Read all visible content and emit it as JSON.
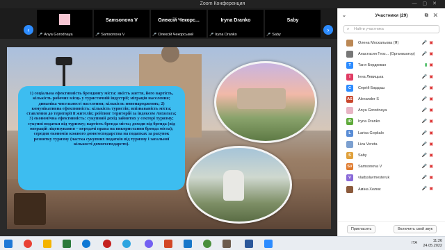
{
  "window": {
    "title": "Zoom Конференция"
  },
  "thumbnails": [
    {
      "name": "",
      "caption": "Anya Gorodnaya"
    },
    {
      "name": "Samsonova V",
      "caption": "Samsonova V"
    },
    {
      "name": "Олексій Чекорс...",
      "caption": "Олексій Чекорський"
    },
    {
      "name": "Iryna Dranko",
      "caption": "Iryna Dranko"
    },
    {
      "name": "Saby",
      "caption": "Saby"
    }
  ],
  "slide": {
    "text": "1) соціальна ефективність брендингу міста: якість життя, його вартість, кількість робочих місць у туристичній індустрії; міграція населення; динаміка чисельності населення; кількість новонароджених; 2) комунікативна ефективність: кількість туристів; впізнаваність міста; ставлення до території її жителів; рейтинг територій за індексом Анхольта; 3) економічна ефективність: сукупний дохід зайнятих у секторі туризму; сукупні податки від туризму; вартість бренда міста; доходи від бренда (від операцій ліцензування – передачі права на використання бренда міста); середня економія кожного домогосподарства на податках за рахунок розвитку туризму (частка сукупних податків від туризму і загальної кількості домогосподарств)."
  },
  "participants_panel": {
    "title": "Участники (29)",
    "search_placeholder": "Найти участника",
    "participants": [
      {
        "name": "Олена Москальова (Я)",
        "initials": "",
        "color": "#b85"
      },
      {
        "name": "Анастасия Геоз... (Организатор)",
        "initials": "",
        "color": "#777"
      },
      {
        "name": "Таня Бордюжан",
        "initials": "T",
        "color": "#2d8cff"
      },
      {
        "name": "Інна Левицька",
        "initials": "I",
        "color": "#e03c64"
      },
      {
        "name": "Сергій Бардаш",
        "initials": "C",
        "color": "#2d8cff"
      },
      {
        "name": "Alexander S",
        "initials": "AS",
        "color": "#c9472d"
      },
      {
        "name": "Anya Gorodnaya",
        "initials": "",
        "color": "#e8b4c4"
      },
      {
        "name": "Iryna Dranko",
        "initials": "ID",
        "color": "#5eaa3a"
      },
      {
        "name": "Larisa Gopkalo",
        "initials": "L",
        "color": "#5a8dd6"
      },
      {
        "name": "Liza Vereta",
        "initials": "",
        "color": "#7ca0d0"
      },
      {
        "name": "Saby",
        "initials": "S",
        "color": "#e0a13c"
      },
      {
        "name": "Samsonova V",
        "initials": "SV",
        "color": "#e07a2d"
      },
      {
        "name": "vladyslavmesteruk",
        "initials": "V",
        "color": "#8a6ad8"
      },
      {
        "name": "Аміна Хелюк",
        "initials": "",
        "color": "#8b5a3c"
      }
    ],
    "invite_label": "Пригласить",
    "unmute_label": "Включить свой звук"
  },
  "taskbar": {
    "tray_text": "ITA",
    "time": "11:26",
    "date": "24.05.2022"
  }
}
